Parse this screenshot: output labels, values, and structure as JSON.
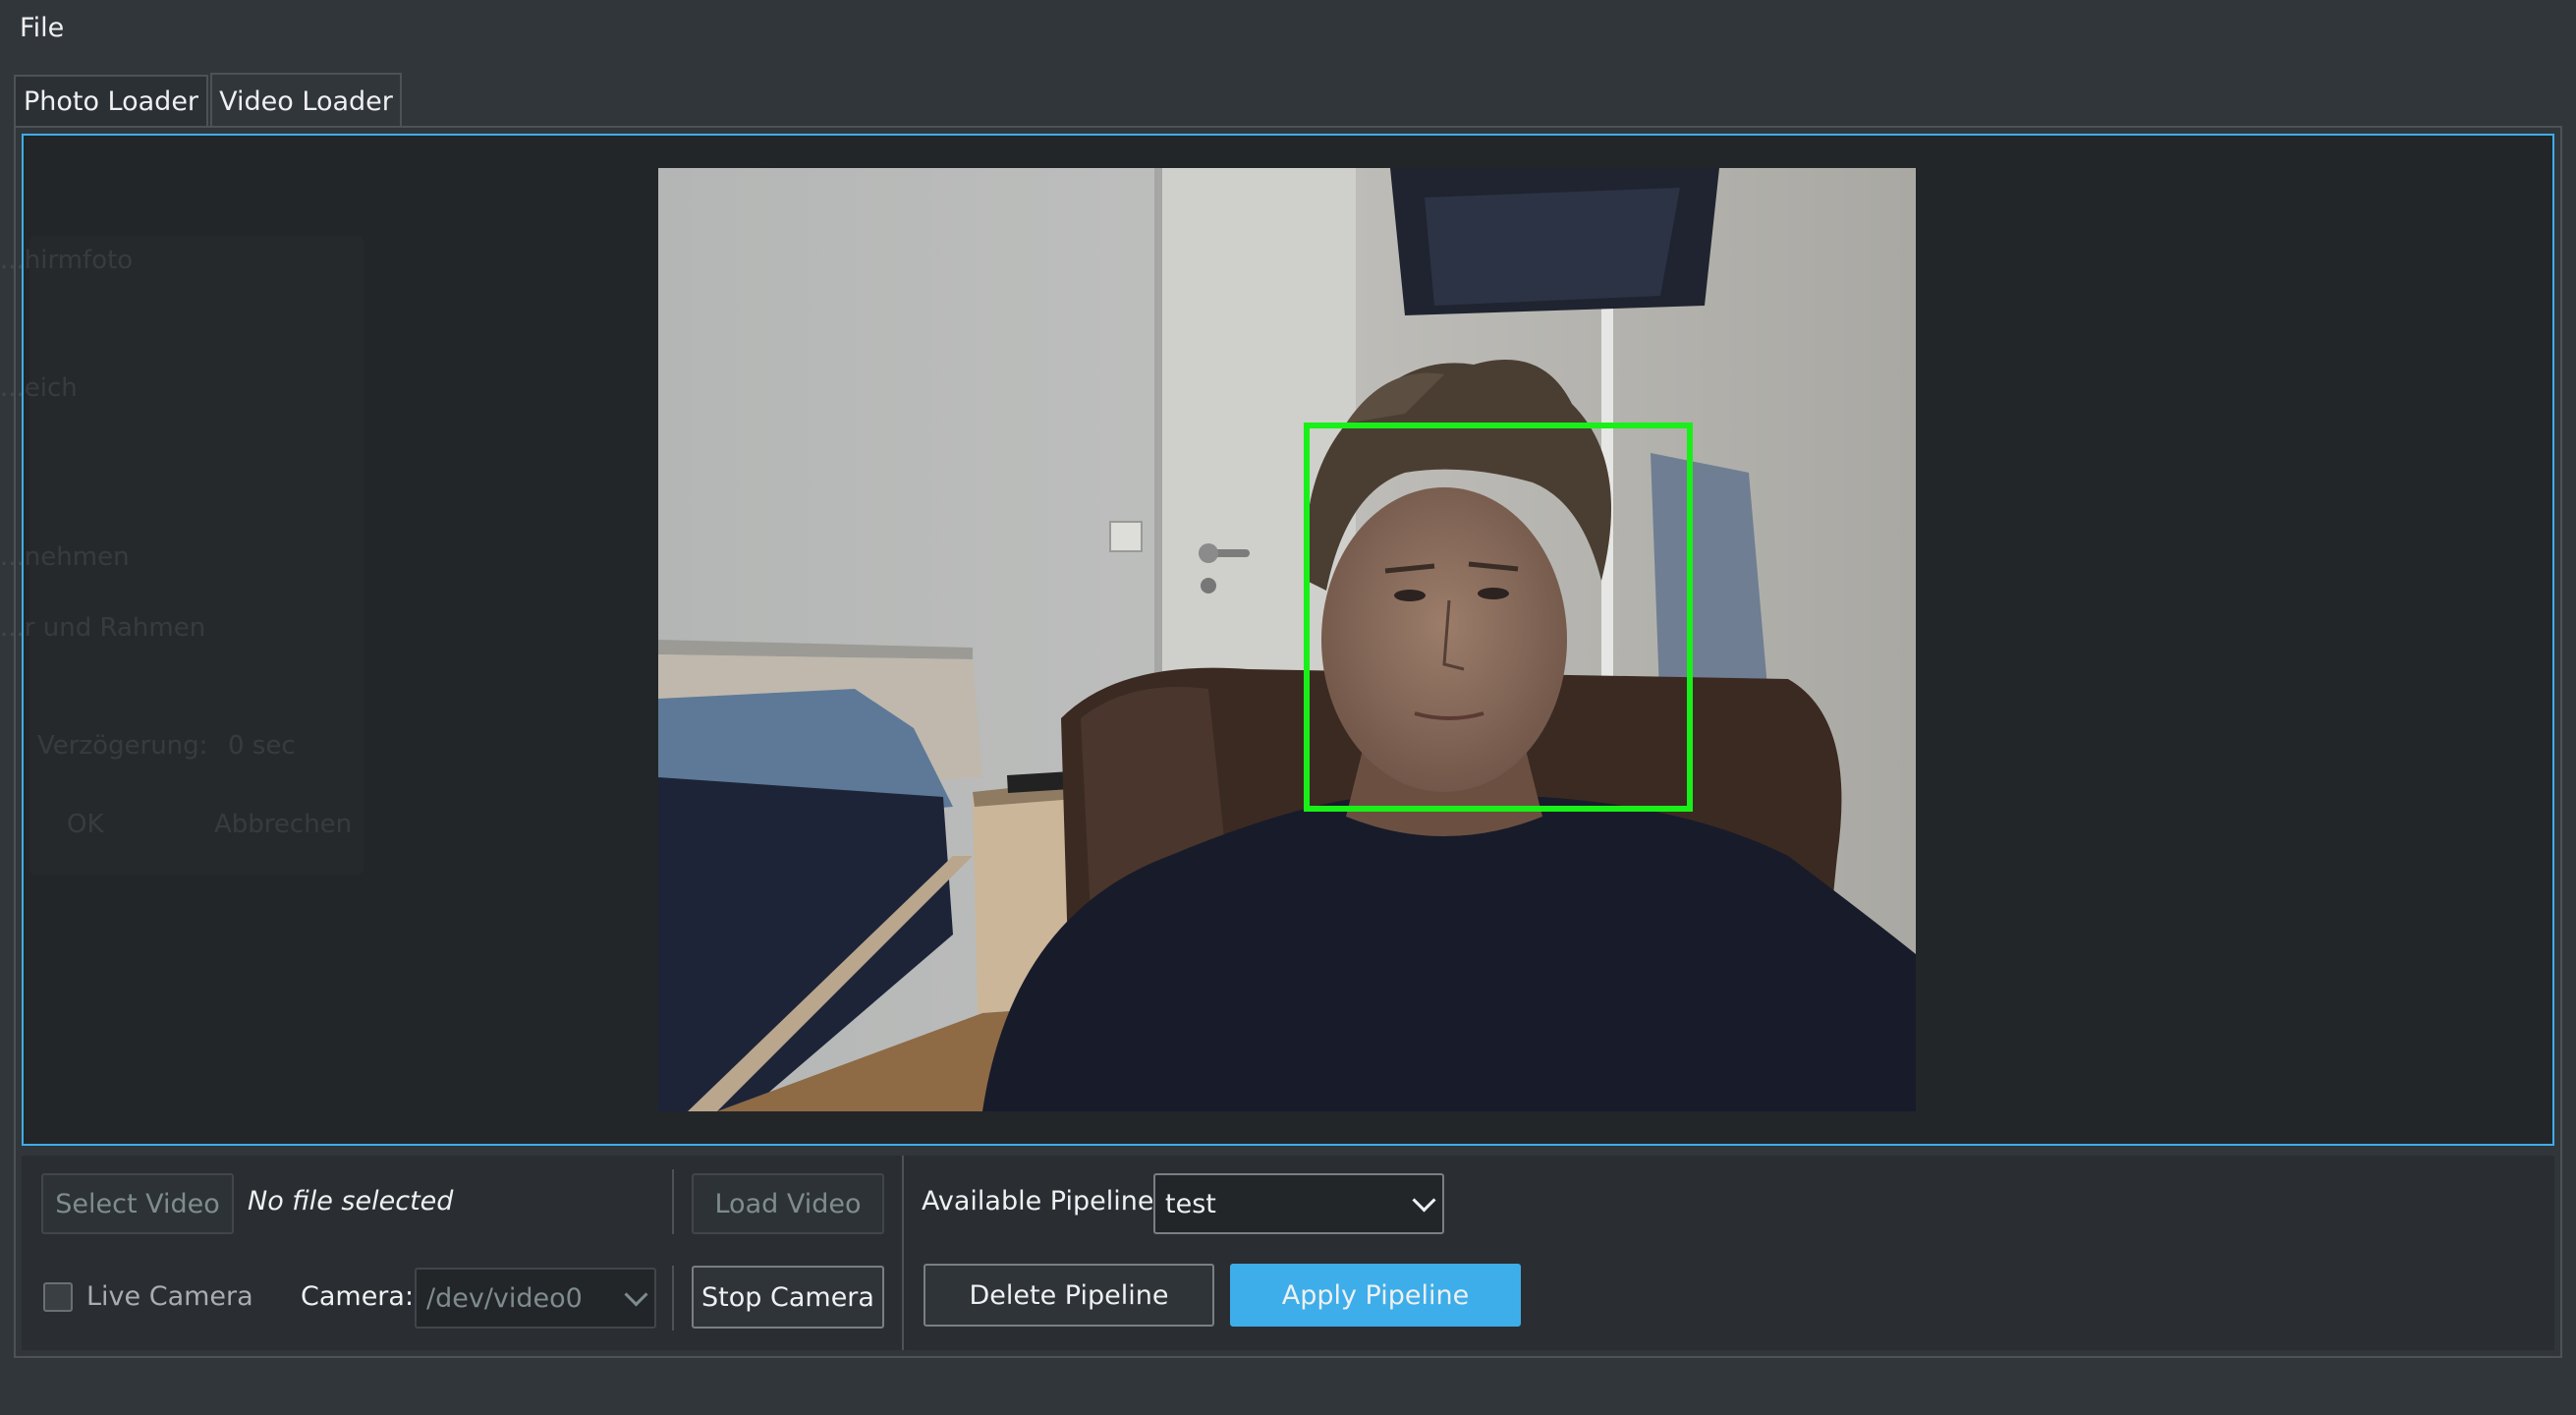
{
  "menu": {
    "file": "File"
  },
  "tabs": [
    {
      "label": "Photo Loader",
      "active": false
    },
    {
      "label": "Video Loader",
      "active": true
    }
  ],
  "video_controls": {
    "select_video_label": "Select Video",
    "file_status": "No file selected",
    "load_video_label": "Load Video",
    "live_camera_label": "Live Camera",
    "live_camera_checked": false,
    "camera_label": "Camera:",
    "camera_value": "/dev/video0",
    "stop_camera_label": "Stop Camera"
  },
  "pipeline": {
    "available_label": "Available Pipeline:",
    "selected": "test",
    "delete_label": "Delete Pipeline",
    "apply_label": "Apply Pipeline"
  },
  "background_ghost": {
    "title": "...hirmfoto",
    "item1": "...eich",
    "item2": "...nehmen",
    "item3": "...r und Rahmen",
    "delay_label": "Verzögerung:",
    "delay_value": "0 sec",
    "ok": "OK",
    "cancel": "Abbrechen"
  },
  "colors": {
    "accent": "#3daee9",
    "face_box": "#18f018",
    "background": "#31363b"
  }
}
